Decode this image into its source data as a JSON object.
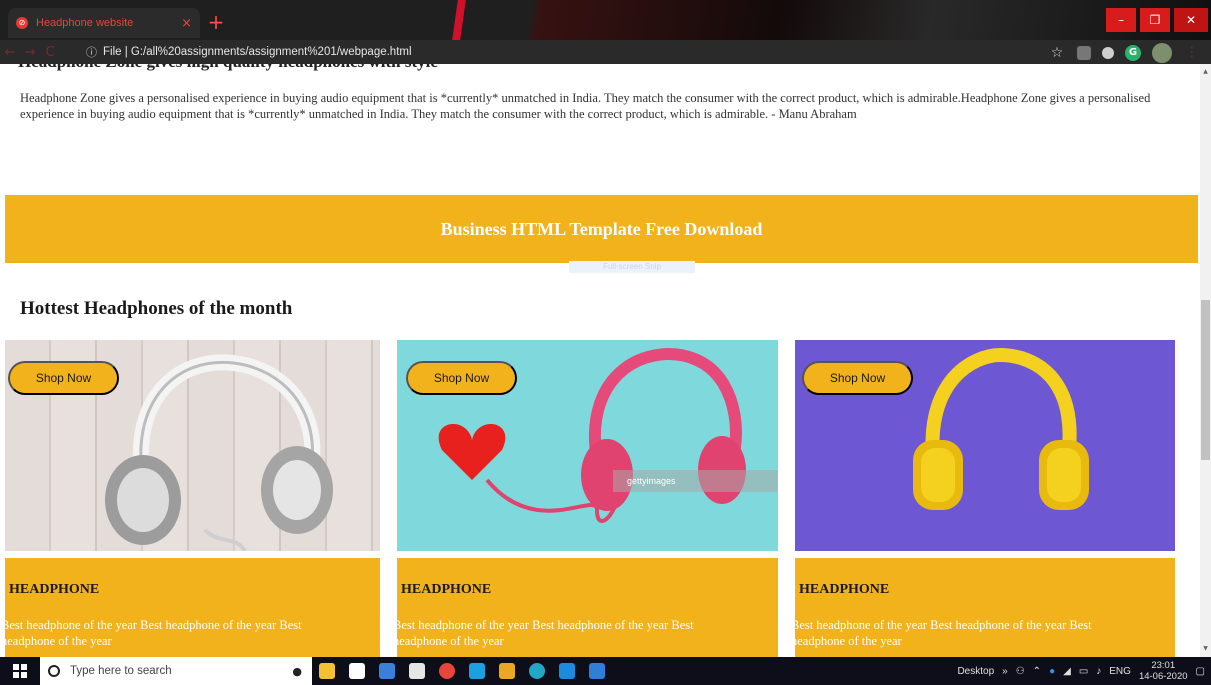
{
  "browser": {
    "tab_title": "Headphone website",
    "tab_close": "×",
    "new_tab": "+",
    "window_controls": {
      "minimize": "–",
      "maximize": "❐",
      "close": "✕"
    },
    "nav": {
      "back": "←",
      "forward": "→",
      "reload": "C"
    },
    "address_info": "ⓘ",
    "address": "File | G:/all%20assignments/assignment%201/webpage.html",
    "bookmark_star": "☆",
    "extensions": [
      "extensions-icon",
      "dot-extension-icon",
      "grammarly-icon",
      "profile-avatar-icon"
    ],
    "grammarly_letter": "G",
    "menu": "⋮"
  },
  "page": {
    "cut_heading": "Headphone Zone gives high quality headphones with style",
    "testimonial": "Headphone Zone gives a personalised experience in buying audio equipment that is *currently* unmatched in India. They match the consumer with the correct product, which is admirable.Headphone Zone gives a personalised experience in buying audio equipment that is *currently* unmatched in India. They match the consumer with the correct product, which is admirable. - Manu Abraham",
    "banner_title": "Business HTML Template Free Download",
    "snip_tooltip": "Full-screen Snip",
    "section_title": "Hottest Headphones of the month",
    "cards": [
      {
        "button": "Shop Now",
        "heading": "HEADPHONE",
        "desc": "Best headphone of the year Best headphone of the year Best headphone of the year"
      },
      {
        "button": "Shop Now",
        "heading": "HEADPHONE",
        "desc": "Best headphone of the year Best headphone of the year Best headphone of the year"
      },
      {
        "button": "Shop Now",
        "heading": "HEADPHONE",
        "desc": "Best headphone of the year Best headphone of the year Best headphone of the year"
      }
    ],
    "watermark": "gettyimages"
  },
  "colors": {
    "accent": "#f2b21b",
    "text": "#1a1a1a",
    "chrome": "#2a2a2a"
  },
  "taskbar": {
    "search_placeholder": "Type here to search",
    "apps": [
      "file-explorer-icon",
      "store-icon",
      "paint-icon",
      "mail-icon",
      "chrome-icon",
      "whatsapp-icon",
      "slack-icon",
      "edge-icon",
      "vscode-icon",
      "instagram-icon"
    ],
    "desktop_label": "Desktop",
    "chevron": "»",
    "language": "ENG",
    "time": "23:01",
    "date": "14-06-2020"
  }
}
